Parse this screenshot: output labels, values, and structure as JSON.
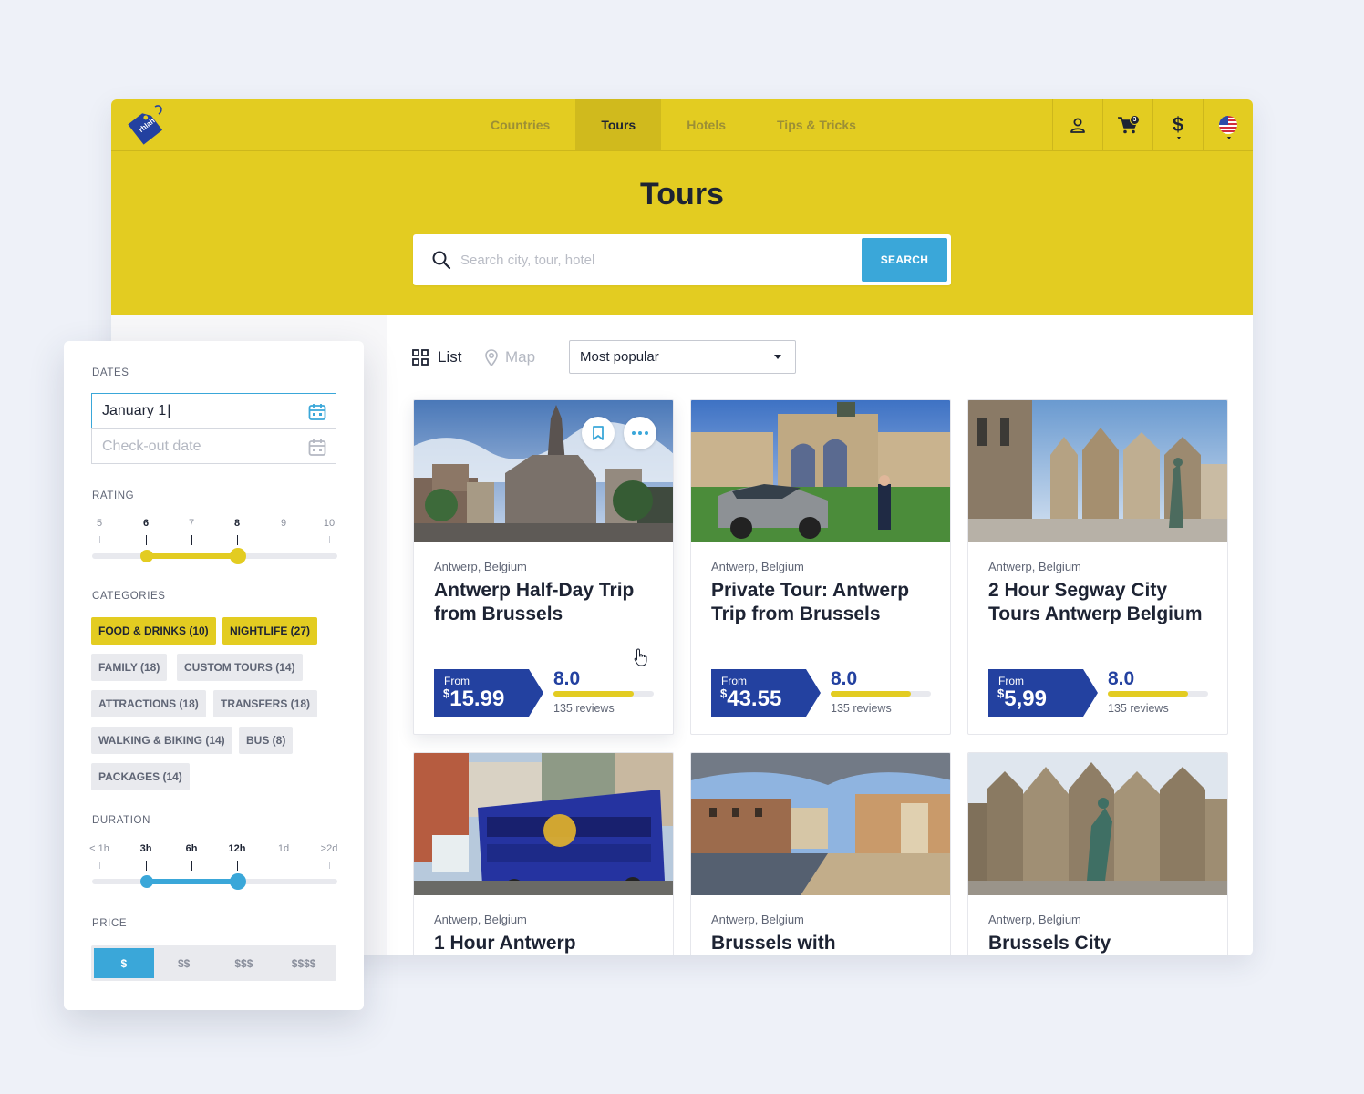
{
  "nav": {
    "items": [
      {
        "label": "Countries",
        "active": false
      },
      {
        "label": "Tours",
        "active": true
      },
      {
        "label": "Hotels",
        "active": false
      },
      {
        "label": "Tips & Tricks",
        "active": false
      }
    ],
    "cart_count": "3",
    "currency_symbol": "$"
  },
  "hero": {
    "title": "Tours",
    "search_placeholder": "Search city, tour, hotel",
    "search_button": "SEARCH"
  },
  "toolbar": {
    "list_label": "List",
    "map_label": "Map",
    "sort_value": "Most popular"
  },
  "cards": [
    {
      "location": "Antwerp, Belgium",
      "title": "Antwerp Half-Day Trip from Brussels",
      "from_label": "From",
      "currency": "$",
      "price": "15.99",
      "rating": "8.0",
      "rating_fraction": 0.8,
      "reviews": "135 reviews"
    },
    {
      "location": "Antwerp, Belgium",
      "title": "Private Tour: Antwerp Trip from Brussels",
      "from_label": "From",
      "currency": "$",
      "price": "43.55",
      "rating": "8.0",
      "rating_fraction": 0.8,
      "reviews": "135 reviews"
    },
    {
      "location": "Antwerp, Belgium",
      "title": "2 Hour Segway City Tours Antwerp Belgium",
      "from_label": "From",
      "currency": "$",
      "price": "5,99",
      "rating": "8.0",
      "rating_fraction": 0.8,
      "reviews": "135 reviews"
    },
    {
      "location": "Antwerp, Belgium",
      "title": "1 Hour Antwerp"
    },
    {
      "location": "Antwerp, Belgium",
      "title": "Brussels with"
    },
    {
      "location": "Antwerp, Belgium",
      "title": "Brussels City"
    }
  ],
  "filters": {
    "dates_label": "DATES",
    "checkin_value": "January 1",
    "checkout_placeholder": "Check-out date",
    "rating_label": "RATING",
    "rating_ticks": [
      "5",
      "6",
      "7",
      "8",
      "9",
      "10"
    ],
    "rating_range": [
      "6",
      "8"
    ],
    "categories_label": "CATEGORIES",
    "categories": [
      {
        "label": "FOOD & DRINKS (10)",
        "selected": true
      },
      {
        "label": "NIGHTLIFE (27)",
        "selected": true
      },
      {
        "label": "FAMILY (18)",
        "selected": false
      },
      {
        "label": "CUSTOM TOURS (14)",
        "selected": false
      },
      {
        "label": "ATTRACTIONS (18)",
        "selected": false
      },
      {
        "label": "TRANSFERS (18)",
        "selected": false
      },
      {
        "label": "WALKING & BIKING (14)",
        "selected": false
      },
      {
        "label": "BUS (8)",
        "selected": false
      },
      {
        "label": "PACKAGES (14)",
        "selected": false
      }
    ],
    "duration_label": "DURATION",
    "duration_ticks": [
      "< 1h",
      "3h",
      "6h",
      "12h",
      "1d",
      ">2d"
    ],
    "duration_range": [
      "3h",
      "12h"
    ],
    "price_label": "PRICE",
    "price_options": [
      {
        "label": "$",
        "selected": true
      },
      {
        "label": "$$",
        "selected": false
      },
      {
        "label": "$$$",
        "selected": false
      },
      {
        "label": "$$$$",
        "selected": false
      }
    ]
  },
  "colors": {
    "brand_yellow": "#e3cc21",
    "accent_blue": "#3aa7d9",
    "price_navy": "#2341a0",
    "text_dark": "#1d2333"
  },
  "icons": [
    "logo-tag-icon",
    "user-icon",
    "cart-icon",
    "dollar-icon",
    "us-flag-icon",
    "search-icon",
    "grid-icon",
    "map-pin-icon",
    "calendar-icon",
    "bookmark-icon",
    "more-icon",
    "hand-cursor-icon"
  ]
}
